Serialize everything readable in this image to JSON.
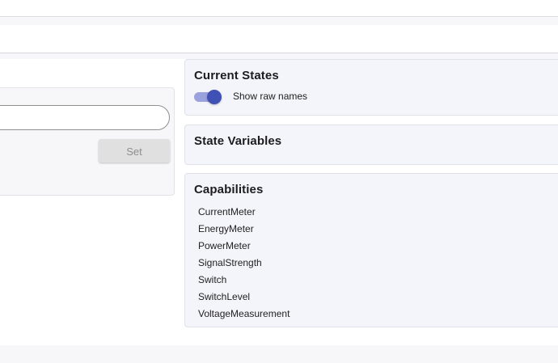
{
  "left_panel": {
    "button": {
      "label": "Set"
    }
  },
  "panels": {
    "current_states": {
      "title": "Current States",
      "toggle": {
        "label": "Show raw names",
        "enabled": true
      }
    },
    "state_variables": {
      "title": "State Variables"
    },
    "capabilities": {
      "title": "Capabilities",
      "items": [
        "CurrentMeter",
        "EnergyMeter",
        "PowerMeter",
        "SignalStrength",
        "Switch",
        "SwitchLevel",
        "VoltageMeasurement"
      ]
    }
  },
  "colors": {
    "accent": "#3f51b5",
    "accent_light": "#9aa2dd",
    "panel_background": "#f4f4fb"
  }
}
